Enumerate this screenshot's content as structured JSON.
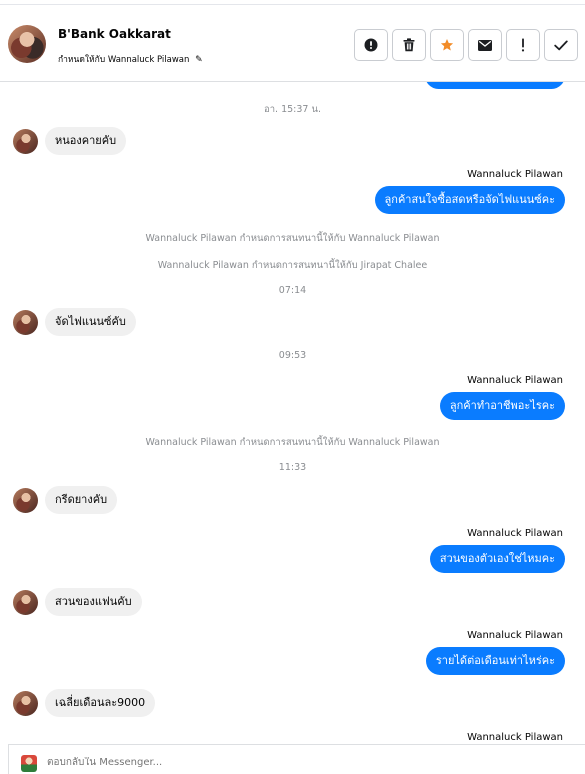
{
  "header": {
    "name": "B'Bank Oakkarat",
    "assign_prefix": "กำหนดให้กับ",
    "assignee": "Wannaluck Pilawan"
  },
  "toolbar": {
    "buttons": [
      {
        "icon": "alert-circle-icon",
        "label": "Mark as spam"
      },
      {
        "icon": "trash-icon",
        "label": "Delete"
      },
      {
        "icon": "star-icon",
        "label": "Follow up",
        "color": "#f28c28"
      },
      {
        "icon": "mail-icon",
        "label": "Mark as unread"
      },
      {
        "icon": "exclamation-icon",
        "label": "Important"
      },
      {
        "icon": "check-icon",
        "label": "Done"
      }
    ]
  },
  "thread": {
    "timestamps": [
      "อา. 15:37 น.",
      "07:14",
      "09:53",
      "11:33"
    ],
    "system": [
      "Wannaluck Pilawan กำหนดการสนทนานี้ให้กับ Wannaluck Pilawan",
      "Wannaluck Pilawan กำหนดการสนทนานี้ให้กับ Jirapat Chalee",
      "Wannaluck Pilawan กำหนดการสนทนานี้ให้กับ Wannaluck Pilawan"
    ],
    "incoming": [
      "หนองคายคับ",
      "จัดไฟแนนซ์คับ",
      "กรีดยางคับ",
      "สวนของแฟนคับ",
      "เฉลี่ยเดือนละ9000"
    ],
    "sender": "Wannaluck Pilawan",
    "outgoing": [
      "ลูกค้าสนใจซื้อสดหรือจัดไฟแนนซ์คะ",
      "ลูกค้าทำอาชีพอะไรคะ",
      "สวนของตัวเองใช่ไหมคะ",
      "รายได้ต่อเดือนเท่าไหร่คะ"
    ]
  },
  "composer": {
    "placeholder": "ตอบกลับใน Messenger..."
  },
  "colors": {
    "accent": "#0a7cff",
    "incoming_bubble": "#f0f0f0",
    "meta_text": "#8a8d91"
  }
}
